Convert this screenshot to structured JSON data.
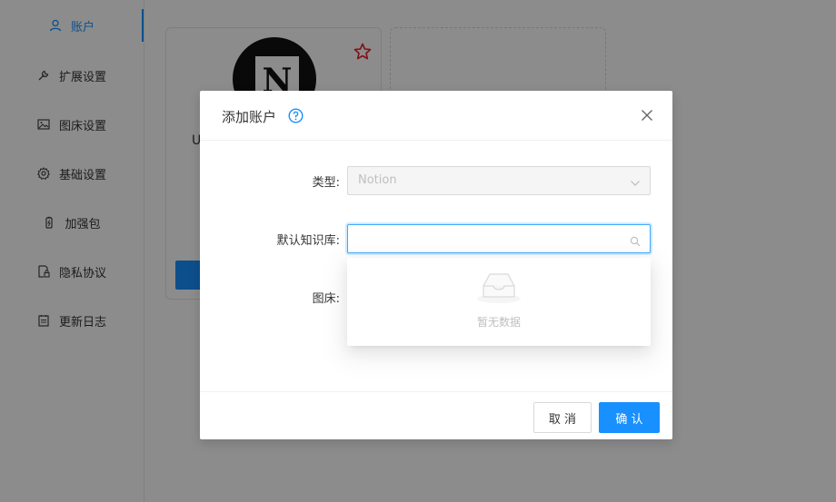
{
  "sidebar": {
    "items": [
      {
        "label": "账户",
        "icon": "user-icon",
        "active": true
      },
      {
        "label": "扩展设置",
        "icon": "wrench-icon"
      },
      {
        "label": "图床设置",
        "icon": "image-icon"
      },
      {
        "label": "基础设置",
        "icon": "gear-icon"
      },
      {
        "label": "加强包",
        "icon": "battery-icon"
      },
      {
        "label": "隐私协议",
        "icon": "privacy-doc-icon"
      },
      {
        "label": "更新日志",
        "icon": "log-icon"
      }
    ]
  },
  "main": {
    "card": {
      "name_partial": "U",
      "logo_letter": "N"
    }
  },
  "modal": {
    "title": "添加账户",
    "fields": {
      "type_label": "类型:",
      "type_value": "Notion",
      "kb_label": "默认知识库:",
      "kb_value": "",
      "bed_label": "图床:"
    },
    "dropdown": {
      "empty_text": "暂无数据"
    },
    "footer": {
      "cancel_label": "取 消",
      "ok_label": "确 认"
    }
  },
  "colors": {
    "primary": "#1890ff",
    "star": "#e8202a"
  }
}
